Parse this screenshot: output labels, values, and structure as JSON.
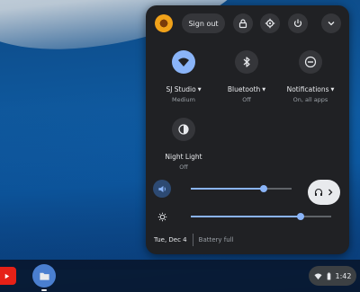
{
  "quick_settings": {
    "sign_out_label": "Sign out",
    "tiles": [
      {
        "label": "SJ Studio",
        "sub": "Medium",
        "has_caret": true,
        "active": true,
        "icon": "wifi-icon"
      },
      {
        "label": "Bluetooth",
        "sub": "Off",
        "has_caret": true,
        "active": false,
        "icon": "bluetooth-icon"
      },
      {
        "label": "Notifications",
        "sub": "On, all apps",
        "has_caret": true,
        "active": false,
        "icon": "notifications-icon"
      },
      {
        "label": "Night Light",
        "sub": "Off",
        "has_caret": false,
        "active": false,
        "icon": "night-light-icon"
      }
    ],
    "volume_level": 0.72,
    "brightness_level": 0.78,
    "date": "Tue, Dec 4",
    "battery_status": "Battery full"
  },
  "shelf": {
    "time": "1:42",
    "apps": [
      "youtube-icon",
      "files-icon"
    ]
  },
  "colors": {
    "accent": "#8ab4f8",
    "panel": "#202124",
    "button": "#35363a"
  }
}
